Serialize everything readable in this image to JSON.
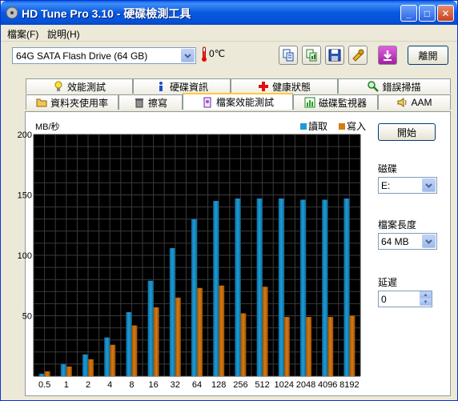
{
  "window": {
    "title": "HD Tune Pro 3.10 - 硬碟檢測工具",
    "minimize": "_",
    "maximize": "□",
    "close": "✕"
  },
  "menu": {
    "file": "檔案(F)",
    "help": "說明(H)"
  },
  "toolbar": {
    "drive": "64G SATA Flash Drive (64 GB)",
    "temperature": "0℃",
    "exit_label": "離開",
    "icons": [
      "copy-text-icon",
      "copy-image-icon",
      "save-icon",
      "settings-icon",
      "download-icon"
    ]
  },
  "tabs_row1": [
    {
      "label": "效能測試",
      "icon": "bulb-icon"
    },
    {
      "label": "硬碟資訊",
      "icon": "info-icon"
    },
    {
      "label": "健康狀態",
      "icon": "health-cross-icon"
    },
    {
      "label": "錯誤掃描",
      "icon": "magnifier-icon"
    }
  ],
  "tabs_row2": [
    {
      "label": "資料夾使用率",
      "icon": "folder-icon"
    },
    {
      "label": "擦寫",
      "icon": "trash-icon"
    },
    {
      "label": "檔案效能測試",
      "icon": "file-bench-icon",
      "active": true
    },
    {
      "label": "磁碟監視器",
      "icon": "monitor-chart-icon"
    },
    {
      "label": "AAM",
      "icon": "speaker-icon"
    }
  ],
  "side": {
    "start_label": "開始",
    "disk_label": "磁碟",
    "disk_value": "E:",
    "file_length_label": "檔案長度",
    "file_length_value": "64 MB",
    "delay_label": "延遲",
    "delay_value": "0"
  },
  "chart_data": {
    "type": "bar",
    "ylabel": "MB/秒",
    "ylim": [
      0,
      200
    ],
    "yticks": [
      50,
      100,
      150,
      200
    ],
    "categories": [
      "0.5",
      "1",
      "2",
      "4",
      "8",
      "16",
      "32",
      "64",
      "128",
      "256",
      "512",
      "1024",
      "2048",
      "4096",
      "8192"
    ],
    "series": [
      {
        "name": "讀取",
        "color": "#1E9BD7",
        "values": [
          2,
          10,
          18,
          32,
          53,
          79,
          106,
          130,
          145,
          147,
          147,
          147,
          146,
          146,
          147
        ]
      },
      {
        "name": "寫入",
        "color": "#D87A10",
        "values": [
          4,
          8,
          14,
          26,
          42,
          57,
          65,
          73,
          75,
          52,
          74,
          49,
          49,
          49,
          50
        ]
      }
    ],
    "grid": true,
    "legend": "top-right"
  }
}
